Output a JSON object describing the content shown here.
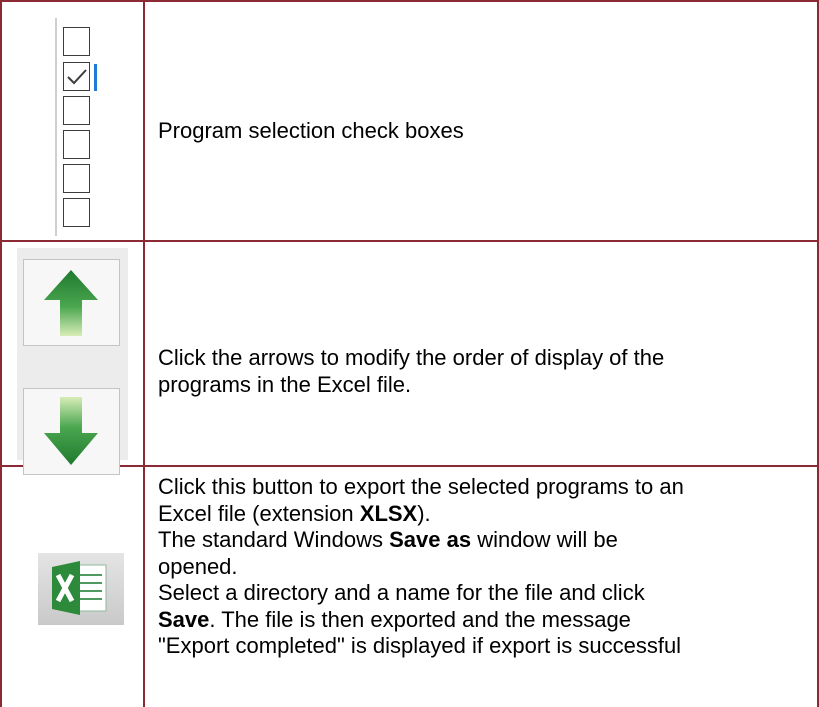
{
  "rows": [
    {
      "description": "Program selection check boxes",
      "checkboxes": [
        false,
        true,
        false,
        false,
        false,
        false
      ],
      "icon": "checkbox-list-icon"
    },
    {
      "description_line1": "Click the arrows to modify the order of display of the",
      "description_line2": "programs in the Excel file.",
      "icons": [
        "arrow-up-icon",
        "arrow-down-icon"
      ]
    },
    {
      "line1_a": "Click this button to export the selected programs to an",
      "line2_a": "Excel file (extension ",
      "line2_bold": "XLSX",
      "line2_b": ").",
      "line3_a": "The standard Windows ",
      "line3_bold": "Save as",
      "line3_b": " window will be",
      "line4": "opened.",
      "line5": "Select a directory and a name for the file and click",
      "line6_bold": "Save",
      "line6_a": ". The file is then exported and the message",
      "line7": "\"Export completed\" is displayed if export is successful",
      "icon": "excel-export-icon"
    }
  ],
  "colors": {
    "border": "#8b2a35",
    "arrow_green": "#2f8f3a",
    "focus": "#1e7ad6"
  }
}
